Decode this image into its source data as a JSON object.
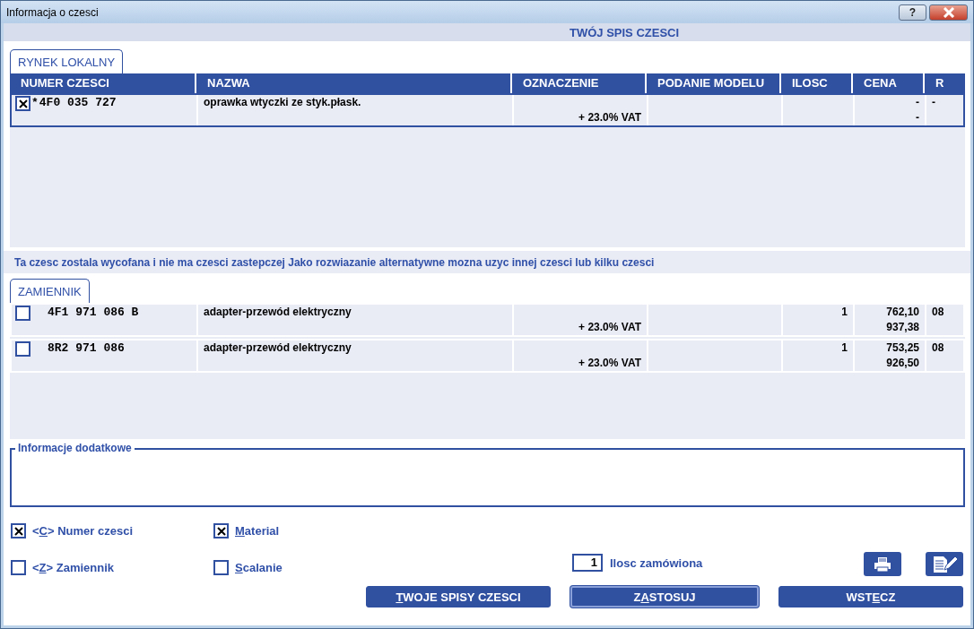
{
  "window": {
    "title": "Informacja o czesci",
    "help": "?"
  },
  "header": "TWÓJ SPIS CZESCI",
  "parts_table": {
    "tab": {
      "label": "RYNEK LOKALNY",
      "selected": true
    },
    "columns": [
      "NUMER CZESCI",
      "NAZWA",
      "OZNACZENIE",
      "PODANIE MODELU",
      "ILOSC",
      "CENA",
      "R"
    ],
    "rows": [
      {
        "checked": true,
        "selected": true,
        "marker": "*",
        "number": "4F0 035 727",
        "name": "oprawka wtyczki ze styk.płask.",
        "designation": "+ 23.0% VAT",
        "price_net": "-",
        "price_gross": "-",
        "r": "-"
      }
    ]
  },
  "message": "Ta czesc zostala wycofana i nie ma czesci zastepczej Jako rozwiazanie alternatywne mozna uzyc innej czesci lub kilku czesci",
  "replacement_table": {
    "tab": {
      "label": "ZAMIENNIK",
      "selected": true
    },
    "rows": [
      {
        "checked": false,
        "selected": false,
        "number": "4F1 971 086 B",
        "name": "adapter-przewód elektryczny",
        "designation": "+ 23.0% VAT",
        "qty": "1",
        "price_net": "762,10",
        "price_gross": "937,38",
        "r": "08"
      },
      {
        "checked": false,
        "selected": false,
        "number": "8R2 971 086",
        "name": "adapter-przewód elektryczny",
        "designation": "+ 23.0% VAT",
        "qty": "1",
        "price_net": "753,25",
        "price_gross": "926,50",
        "r": "08"
      }
    ]
  },
  "additional_info": {
    "label": "Informacje dodatkowe"
  },
  "options": [
    {
      "before": "<",
      "key": "C",
      "after": "> Numer czesci",
      "checked": true
    },
    {
      "key": "M",
      "after": "aterial",
      "checked": true
    },
    {
      "before": "<",
      "key": "Z",
      "after": "> Zamiennik",
      "checked": false
    },
    {
      "key": "S",
      "after": "calanie",
      "checked": false
    }
  ],
  "quantity": {
    "value": "1",
    "label": "Ilosc zamówiona"
  },
  "buttons": [
    {
      "key": "T",
      "after": "WOJE SPISY CZESCI",
      "focused": false
    },
    {
      "before": "Z",
      "key": "A",
      "after": "STOSUJ",
      "focused": true
    },
    {
      "before": "WST",
      "key": "E",
      "after": "CZ",
      "focused": false
    }
  ]
}
